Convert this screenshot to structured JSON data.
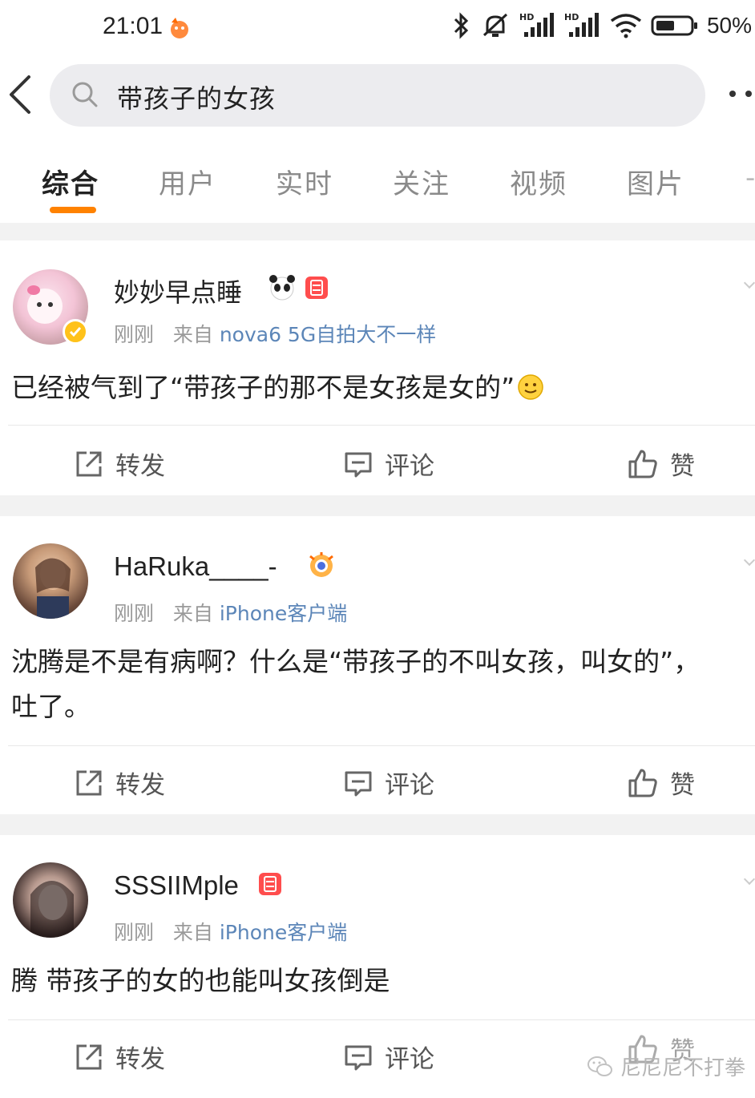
{
  "status_bar": {
    "time": "21:01",
    "battery": "50%",
    "icons": [
      "bluetooth-icon",
      "mute-icon",
      "signal-hd-icon",
      "signal-hd-icon",
      "wifi-icon",
      "battery-icon"
    ]
  },
  "search": {
    "query": "带孩子的女孩"
  },
  "tabs": [
    "综合",
    "用户",
    "实时",
    "关注",
    "视频",
    "图片"
  ],
  "active_tab": "综合",
  "accent_color": "#ff8200",
  "link_color": "#5c86b8",
  "posts": [
    {
      "username": "妙妙早点睡",
      "time": "刚刚",
      "from_label": "来自",
      "source": "nova6 5G自拍大不一样",
      "text": "已经被气到了“带孩子的那不是女孩是女的”",
      "text_line2": "",
      "badges": [
        "panda-emoji",
        "red-vip-badge"
      ],
      "verified": true,
      "actions": {
        "repost": "转发",
        "comment": "评论",
        "like": "赞"
      }
    },
    {
      "username": "HaRuka____-",
      "time": "刚刚",
      "from_label": "来自",
      "source": "iPhone客户端",
      "text": "沈腾是不是有病啊？什么是“带孩子的不叫女孩，叫女的”，",
      "text_line2": "吐了。",
      "badges": [
        "eye-badge"
      ],
      "verified": false,
      "actions": {
        "repost": "转发",
        "comment": "评论",
        "like": "赞"
      }
    },
    {
      "username": "SSSIIMple",
      "time": "刚刚",
      "from_label": "来自",
      "source": "iPhone客户端",
      "text": "腾 带孩子的女的也能叫女孩倒是",
      "text_line2": "",
      "badges": [
        "red-vip-badge"
      ],
      "verified": false,
      "actions": {
        "repost": "转发",
        "comment": "评论",
        "like": "赞"
      }
    }
  ],
  "watermark": "尼尼尼不打拳"
}
